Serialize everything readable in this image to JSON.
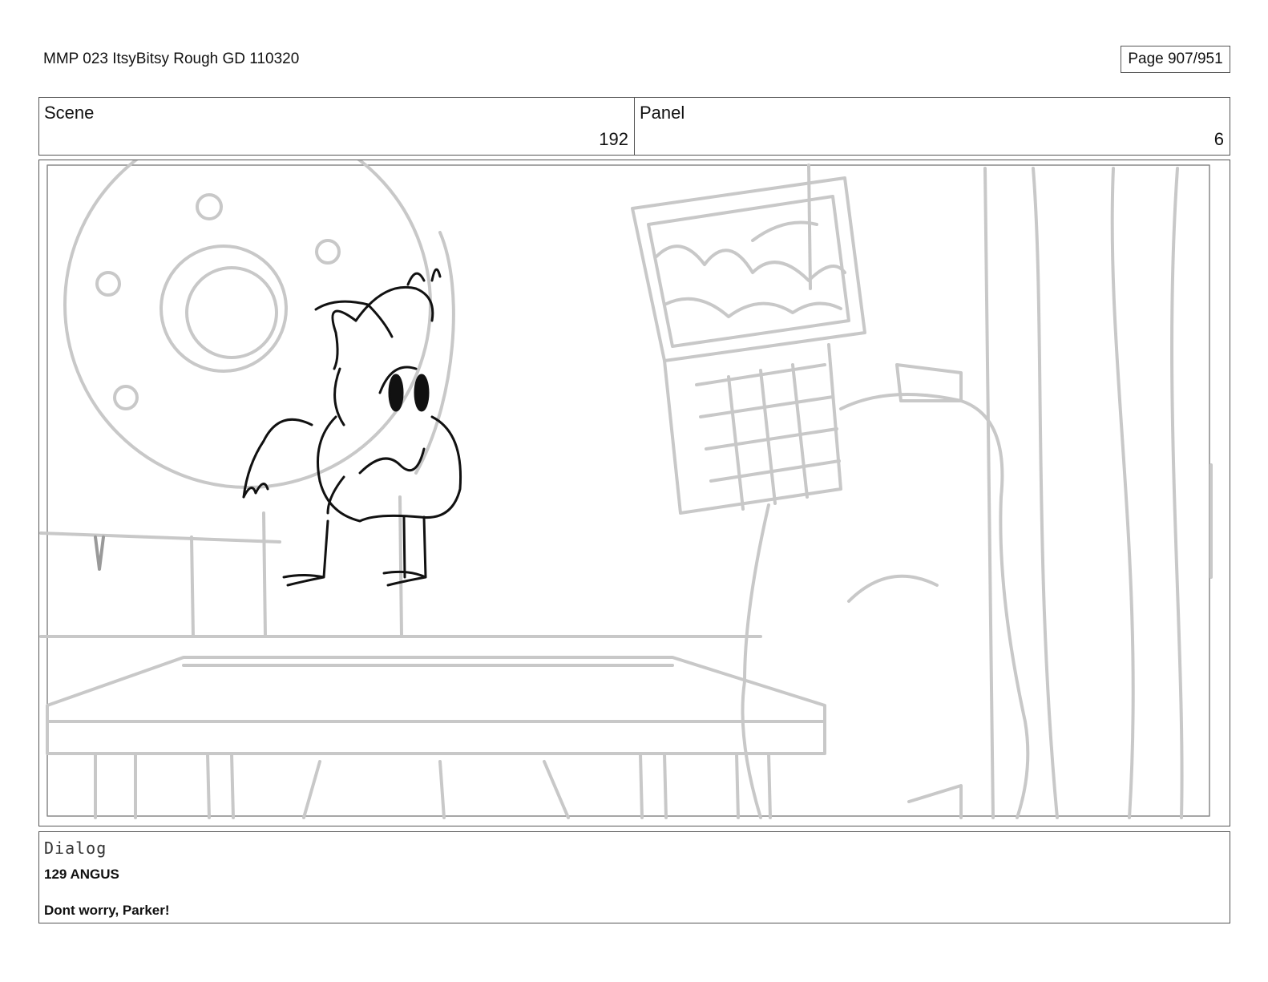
{
  "header": {
    "title": "MMP 023 ItsyBitsy Rough GD 110320",
    "page": "Page 907/951"
  },
  "info": {
    "scene_label": "Scene",
    "scene_value": "192",
    "panel_label": "Panel",
    "panel_value": "6"
  },
  "panel_image": {
    "description_icon": "storyboard-sketch-icon"
  },
  "dialog": {
    "label": "Dialog",
    "character": "129 ANGUS",
    "line": "Dont worry, Parker!"
  },
  "colors": {
    "background_line": "#c8c8c8",
    "character_line": "#111111",
    "border": "#555555"
  }
}
